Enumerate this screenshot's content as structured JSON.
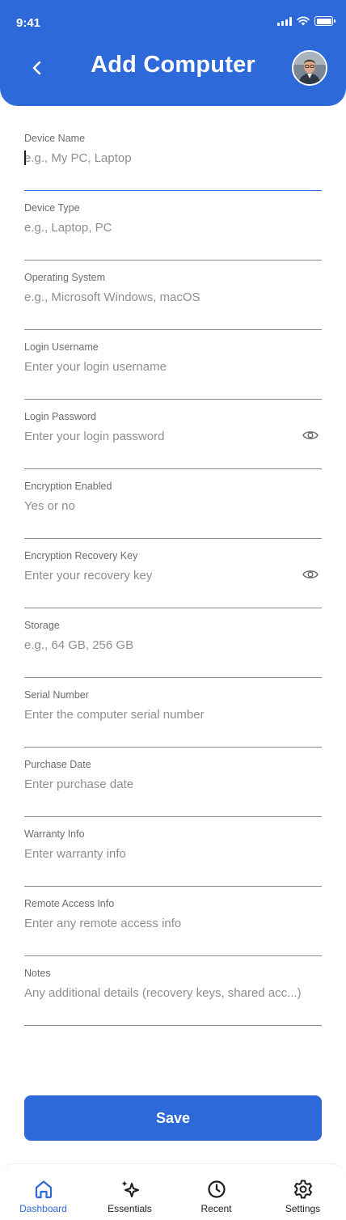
{
  "status_bar": {
    "time": "9:41"
  },
  "header": {
    "title": "Add Computer"
  },
  "form": {
    "fields": [
      {
        "label": "Device Name",
        "placeholder": "e.g., My PC, Laptop"
      },
      {
        "label": "Device Type",
        "placeholder": "e.g., Laptop, PC"
      },
      {
        "label": "Operating System",
        "placeholder": "e.g., Microsoft Windows, macOS"
      },
      {
        "label": "Login Username",
        "placeholder": "Enter your login username"
      },
      {
        "label": "Login Password",
        "placeholder": "Enter your login password"
      },
      {
        "label": "Encryption Enabled",
        "placeholder": "Yes or no"
      },
      {
        "label": "Encryption Recovery Key",
        "placeholder": "Enter your recovery key"
      },
      {
        "label": "Storage",
        "placeholder": "e.g., 64 GB, 256 GB"
      },
      {
        "label": "Serial Number",
        "placeholder": "Enter the computer serial number"
      },
      {
        "label": "Purchase Date",
        "placeholder": "Enter purchase date"
      },
      {
        "label": "Warranty Info",
        "placeholder": "Enter warranty info"
      },
      {
        "label": "Remote Access Info",
        "placeholder": "Enter any remote access info"
      },
      {
        "label": "Notes",
        "placeholder": "Any additional details (recovery keys, shared acc...)"
      }
    ],
    "save_label": "Save"
  },
  "tabbar": {
    "items": [
      {
        "label": "Dashboard",
        "icon": "home-icon",
        "active": true
      },
      {
        "label": "Essentials",
        "icon": "sparkles-icon",
        "active": false
      },
      {
        "label": "Recent",
        "icon": "clock-icon",
        "active": false
      },
      {
        "label": "Settings",
        "icon": "gear-icon",
        "active": false
      }
    ]
  },
  "colors": {
    "accent": "#2d69d9",
    "text": "#1c1c1e",
    "muted": "#8e8e93"
  }
}
